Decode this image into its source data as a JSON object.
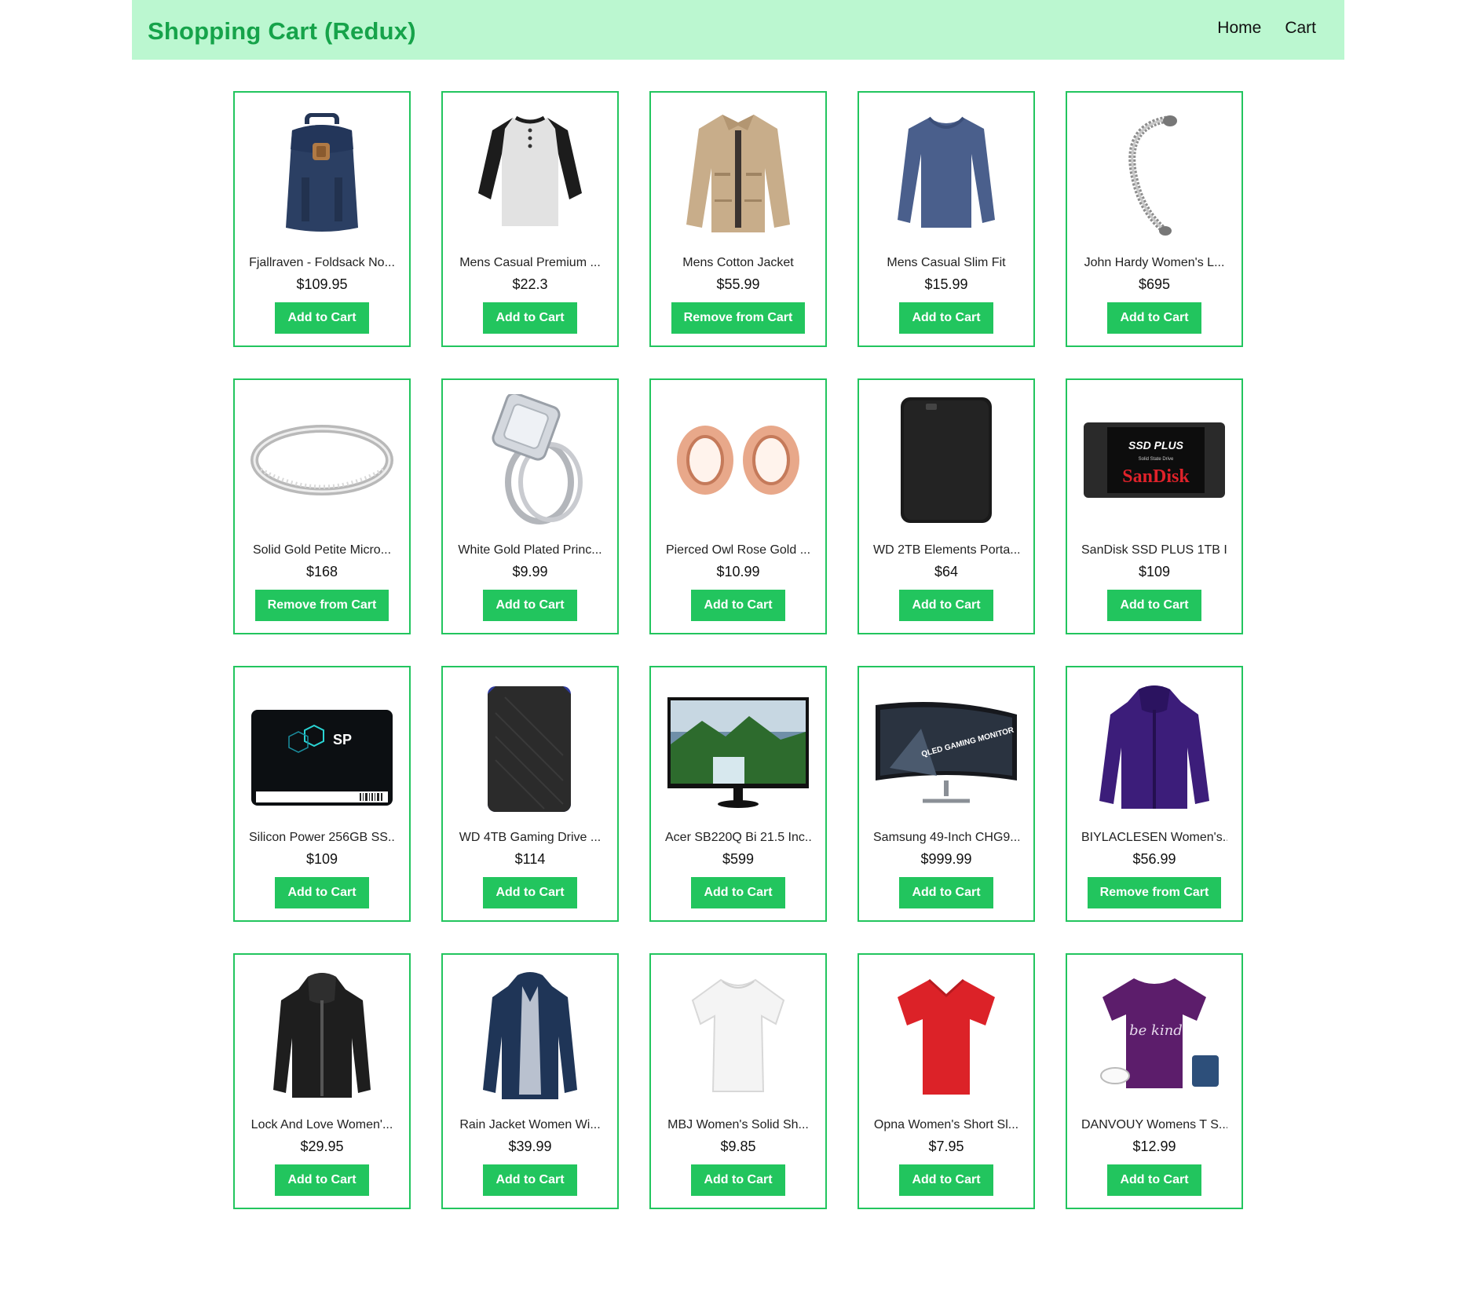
{
  "header": {
    "title": "Shopping Cart (Redux)",
    "nav": [
      "Home",
      "Cart"
    ]
  },
  "theme": {
    "accent": "#22c55e",
    "header_bg": "#bbf7d0",
    "brand_color": "#16a34a"
  },
  "products": [
    {
      "title": "Fjallraven - Foldsack No...",
      "price": "$109.95",
      "action": "Add to Cart",
      "icon": "backpack-icon",
      "in_cart": false
    },
    {
      "title": "Mens Casual Premium ...",
      "price": "$22.3",
      "action": "Add to Cart",
      "icon": "raglan-shirt-icon",
      "in_cart": false
    },
    {
      "title": "Mens Cotton Jacket",
      "price": "$55.99",
      "action": "Remove from Cart",
      "icon": "cotton-jacket-icon",
      "in_cart": true
    },
    {
      "title": "Mens Casual Slim Fit",
      "price": "$15.99",
      "action": "Add to Cart",
      "icon": "long-sleeve-shirt-icon",
      "in_cart": false
    },
    {
      "title": "John Hardy Women's L...",
      "price": "$695",
      "action": "Add to Cart",
      "icon": "bracelet-icon",
      "in_cart": false
    },
    {
      "title": "Solid Gold Petite Micro...",
      "price": "$168",
      "action": "Remove from Cart",
      "icon": "ring-icon",
      "in_cart": true
    },
    {
      "title": "White Gold Plated Princ...",
      "price": "$9.99",
      "action": "Add to Cart",
      "icon": "diamond-ring-icon",
      "in_cart": false
    },
    {
      "title": "Pierced Owl Rose Gold ...",
      "price": "$10.99",
      "action": "Add to Cart",
      "icon": "ear-plugs-icon",
      "in_cart": false
    },
    {
      "title": "WD 2TB Elements Porta...",
      "price": "$64",
      "action": "Add to Cart",
      "icon": "hard-drive-icon",
      "in_cart": false
    },
    {
      "title": "SanDisk SSD PLUS 1TB I...",
      "price": "$109",
      "action": "Add to Cart",
      "icon": "ssd-icon",
      "in_cart": false,
      "label_top": "SSD PLUS",
      "label_sub": "Solid State Drive",
      "brand": "SanDisk"
    },
    {
      "title": "Silicon Power 256GB SS...",
      "price": "$109",
      "action": "Add to Cart",
      "icon": "ssd-black-icon",
      "in_cart": false,
      "brand": "SP"
    },
    {
      "title": "WD 4TB Gaming Drive ...",
      "price": "$114",
      "action": "Add to Cart",
      "icon": "gaming-drive-icon",
      "in_cart": false
    },
    {
      "title": "Acer SB220Q Bi 21.5 Inc...",
      "price": "$599",
      "action": "Add to Cart",
      "icon": "monitor-icon",
      "in_cart": false
    },
    {
      "title": "Samsung 49-Inch CHG9...",
      "price": "$999.99",
      "action": "Add to Cart",
      "icon": "curved-monitor-icon",
      "in_cart": false,
      "screen_text": "QLED GAMING MONITOR"
    },
    {
      "title": "BIYLACLESEN Women's...",
      "price": "$56.99",
      "action": "Remove from Cart",
      "icon": "purple-jacket-icon",
      "in_cart": true
    },
    {
      "title": "Lock And Love Women'...",
      "price": "$29.95",
      "action": "Add to Cart",
      "icon": "leather-jacket-icon",
      "in_cart": false
    },
    {
      "title": "Rain Jacket Women Wi...",
      "price": "$39.99",
      "action": "Add to Cart",
      "icon": "rain-jacket-icon",
      "in_cart": false
    },
    {
      "title": "MBJ Women's Solid Sh...",
      "price": "$9.85",
      "action": "Add to Cart",
      "icon": "white-top-icon",
      "in_cart": false
    },
    {
      "title": "Opna Women's Short Sl...",
      "price": "$7.95",
      "action": "Add to Cart",
      "icon": "red-tshirt-icon",
      "in_cart": false
    },
    {
      "title": "DANVOUY Womens T S...",
      "price": "$12.99",
      "action": "Add to Cart",
      "icon": "purple-tshirt-icon",
      "in_cart": false,
      "print_text": "be kind"
    }
  ]
}
